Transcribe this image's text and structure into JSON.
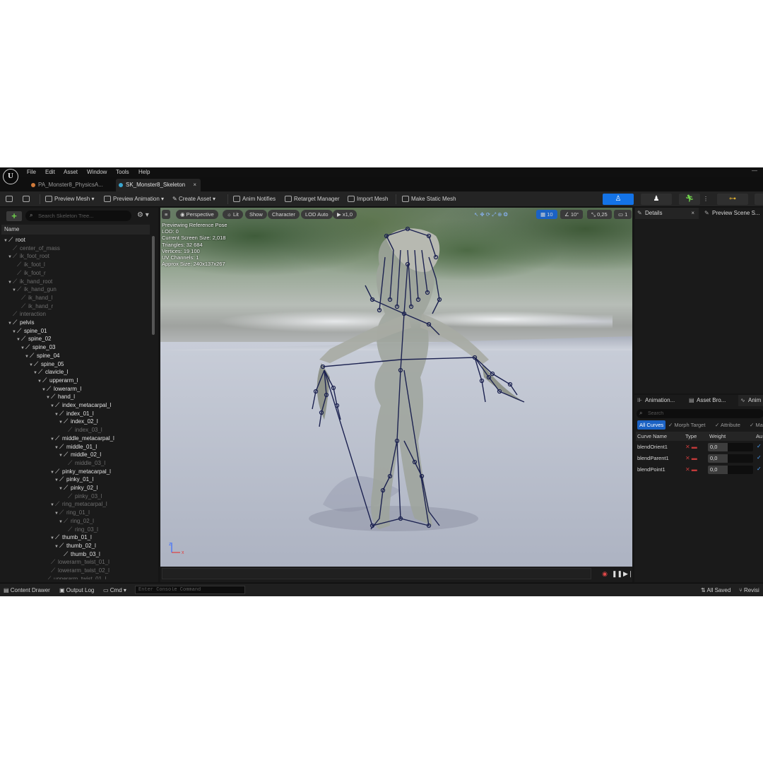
{
  "menu": [
    "File",
    "Edit",
    "Asset",
    "Window",
    "Tools",
    "Help"
  ],
  "logo_text": "U",
  "window_minimize": "—",
  "tabs": [
    {
      "label": "PA_Monster8_PhysicsA...",
      "color": "#d07a3a"
    },
    {
      "label": "SK_Monster8_Skeleton",
      "color": "#3aa6d0"
    }
  ],
  "tab_close": "×",
  "toolbar": {
    "preview_mesh": "Preview Mesh",
    "preview_animation": "Preview Animation",
    "create_asset": "Create Asset",
    "anim_notifies": "Anim Notifies",
    "retarget_manager": "Retarget Manager",
    "import_mesh": "Import Mesh",
    "make_static_mesh": "Make Static Mesh",
    "more": "⋮"
  },
  "tree": {
    "search_placeholder": "Search Skeleton Tree...",
    "add": "+",
    "header": "Name",
    "bones": [
      {
        "name": "root",
        "depth": 0,
        "lit": true,
        "open": true
      },
      {
        "name": "center_of_mass",
        "depth": 1,
        "lit": false,
        "open": false
      },
      {
        "name": "ik_foot_root",
        "depth": 1,
        "lit": false,
        "open": true
      },
      {
        "name": "ik_foot_l",
        "depth": 2,
        "lit": false,
        "open": false
      },
      {
        "name": "ik_foot_r",
        "depth": 2,
        "lit": false,
        "open": false
      },
      {
        "name": "ik_hand_root",
        "depth": 1,
        "lit": false,
        "open": true
      },
      {
        "name": "ik_hand_gun",
        "depth": 2,
        "lit": false,
        "open": true
      },
      {
        "name": "ik_hand_l",
        "depth": 3,
        "lit": false,
        "open": false
      },
      {
        "name": "ik_hand_r",
        "depth": 3,
        "lit": false,
        "open": false
      },
      {
        "name": "interaction",
        "depth": 1,
        "lit": false,
        "open": false
      },
      {
        "name": "pelvis",
        "depth": 1,
        "lit": true,
        "open": true
      },
      {
        "name": "spine_01",
        "depth": 2,
        "lit": true,
        "open": true
      },
      {
        "name": "spine_02",
        "depth": 3,
        "lit": true,
        "open": true
      },
      {
        "name": "spine_03",
        "depth": 4,
        "lit": true,
        "open": true
      },
      {
        "name": "spine_04",
        "depth": 5,
        "lit": true,
        "open": true
      },
      {
        "name": "spine_05",
        "depth": 6,
        "lit": true,
        "open": true
      },
      {
        "name": "clavicle_l",
        "depth": 7,
        "lit": true,
        "open": true
      },
      {
        "name": "upperarm_l",
        "depth": 8,
        "lit": true,
        "open": true
      },
      {
        "name": "lowerarm_l",
        "depth": 9,
        "lit": true,
        "open": true
      },
      {
        "name": "hand_l",
        "depth": 10,
        "lit": true,
        "open": true
      },
      {
        "name": "index_metacarpal_l",
        "depth": 11,
        "lit": true,
        "open": true
      },
      {
        "name": "index_01_l",
        "depth": 12,
        "lit": true,
        "open": true
      },
      {
        "name": "index_02_l",
        "depth": 13,
        "lit": true,
        "open": true
      },
      {
        "name": "index_03_l",
        "depth": 14,
        "lit": false,
        "open": false
      },
      {
        "name": "middle_metacarpal_l",
        "depth": 11,
        "lit": true,
        "open": true
      },
      {
        "name": "middle_01_l",
        "depth": 12,
        "lit": true,
        "open": true
      },
      {
        "name": "middle_02_l",
        "depth": 13,
        "lit": true,
        "open": true
      },
      {
        "name": "middle_03_l",
        "depth": 14,
        "lit": false,
        "open": false
      },
      {
        "name": "pinky_metacarpal_l",
        "depth": 11,
        "lit": true,
        "open": true
      },
      {
        "name": "pinky_01_l",
        "depth": 12,
        "lit": true,
        "open": true
      },
      {
        "name": "pinky_02_l",
        "depth": 13,
        "lit": true,
        "open": true
      },
      {
        "name": "pinky_03_l",
        "depth": 14,
        "lit": false,
        "open": false
      },
      {
        "name": "ring_metacarpal_l",
        "depth": 11,
        "lit": false,
        "open": true
      },
      {
        "name": "ring_01_l",
        "depth": 12,
        "lit": false,
        "open": true
      },
      {
        "name": "ring_02_l",
        "depth": 13,
        "lit": false,
        "open": true
      },
      {
        "name": "ring_03_l",
        "depth": 14,
        "lit": false,
        "open": false
      },
      {
        "name": "thumb_01_l",
        "depth": 11,
        "lit": true,
        "open": true
      },
      {
        "name": "thumb_02_l",
        "depth": 12,
        "lit": true,
        "open": true
      },
      {
        "name": "thumb_03_l",
        "depth": 13,
        "lit": true,
        "open": false
      },
      {
        "name": "lowerarm_twist_01_l",
        "depth": 10,
        "lit": false,
        "open": false
      },
      {
        "name": "lowerarm_twist_02_l",
        "depth": 10,
        "lit": false,
        "open": false
      },
      {
        "name": "upperarm_twist_01_l",
        "depth": 9,
        "lit": false,
        "open": false
      }
    ]
  },
  "viewport": {
    "menu_icon": "≡",
    "perspective": "Perspective",
    "lit": "Lit",
    "show": "Show",
    "character": "Character",
    "lod": "LOD Auto",
    "play_rate": "x1,0",
    "grid_size": "10",
    "rot_snap": "10°",
    "scale_snap": "0,25",
    "camera_speed": "1",
    "stats": [
      "Previewing Reference Pose",
      "LOD: 0",
      "Current Screen Size: 2,018",
      "Triangles: 32 684",
      "Vertices: 19 100",
      "UV Channels: 1",
      "Approx Size: 240x137x267"
    ],
    "axis_x": "x",
    "axis_z": "z"
  },
  "details": {
    "tab_details": "Details",
    "tab_preview": "Preview Scene S...",
    "close": "×"
  },
  "curves": {
    "tab_animation": "Animation...",
    "tab_asset": "Asset Bro...",
    "tab_anim": "Anim",
    "search_placeholder": "Search",
    "filters": [
      "All Curves",
      "Morph Target",
      "Attribute",
      "Ma"
    ],
    "headers": [
      "Curve Name",
      "Type",
      "Weight",
      "Au"
    ],
    "rows": [
      {
        "name": "blendOrient1",
        "weight": "0,0"
      },
      {
        "name": "blendParent1",
        "weight": "0,0"
      },
      {
        "name": "blendPoint1",
        "weight": "0,0"
      }
    ]
  },
  "statusbar": {
    "content_drawer": "Content Drawer",
    "output_log": "Output Log",
    "cmd": "Cmd",
    "console_placeholder": "Enter Console Command",
    "all_saved": "All Saved",
    "revision": "Revisi"
  },
  "colors": {
    "accent": "#1473e6",
    "panel": "#1a1a1a",
    "bone_lines": "#1c2250"
  }
}
